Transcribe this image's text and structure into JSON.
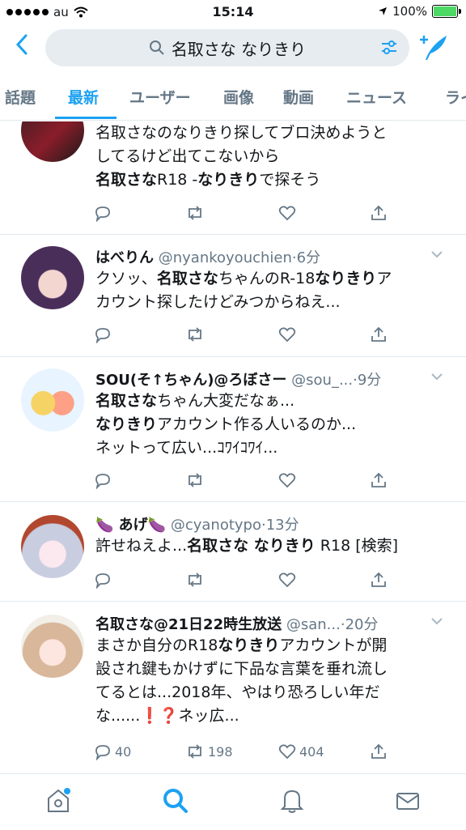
{
  "status_bar": {
    "carrier": "au",
    "time": "15:14",
    "battery": "100%",
    "battery_level": 1.0
  },
  "search": {
    "query": "名取さな なりきり"
  },
  "tabs": [
    "話題",
    "最新",
    "ユーザー",
    "画像",
    "動画",
    "ニュース",
    "ライ"
  ],
  "active_tab": "最新",
  "tweets": [
    {
      "name": "",
      "handle": "",
      "time": "",
      "body": [
        {
          "t": "名取さなのなりきり探してブロ決めようと"
        },
        {
          "br": true
        },
        {
          "t": "してるけど出てこないから"
        },
        {
          "br": true
        },
        {
          "t": "名取さな",
          "b": true
        },
        {
          "t": "R18 -"
        },
        {
          "t": "なりきり",
          "b": true
        },
        {
          "t": "で探そう"
        }
      ],
      "reply_count": "",
      "retweet_count": "",
      "like_count": ""
    },
    {
      "name": "はべりん",
      "handle": "@nyankoyouchien",
      "time": "6分",
      "body": [
        {
          "t": "クソッ、"
        },
        {
          "t": "名取さな",
          "b": true
        },
        {
          "t": "ちゃんのR-18"
        },
        {
          "t": "なりきり",
          "b": true
        },
        {
          "t": "ア"
        },
        {
          "br": true
        },
        {
          "t": "カウント探したけどみつからねえ..."
        }
      ],
      "reply_count": "",
      "retweet_count": "",
      "like_count": ""
    },
    {
      "name": "SOU(そ↑ちゃん)@ろぼさー",
      "handle": "@sou_...",
      "time": "9分",
      "body": [
        {
          "t": "名取さな",
          "b": true
        },
        {
          "t": "ちゃん大変だなぁ..."
        },
        {
          "br": true
        },
        {
          "t": "なりきり",
          "b": true
        },
        {
          "t": "アカウント作る人いるのか..."
        },
        {
          "br": true
        },
        {
          "t": "ネットって広い...ｺﾜｲｺﾜｲ..."
        }
      ],
      "reply_count": "",
      "retweet_count": "",
      "like_count": ""
    },
    {
      "name": "🍆 あげ🍆",
      "handle": "@cyanotypo",
      "time": "13分",
      "body": [
        {
          "t": "許せねえよ..."
        },
        {
          "t": "名取さな なりきり",
          "b": true
        },
        {
          "t": " R18 [検索]"
        }
      ],
      "reply_count": "",
      "retweet_count": "",
      "like_count": ""
    },
    {
      "name": "名取さな@21日22時生放送",
      "handle": "@san...",
      "time": "20分",
      "body": [
        {
          "t": "まさか自分のR18"
        },
        {
          "t": "なりきり",
          "b": true
        },
        {
          "t": "アカウントが開"
        },
        {
          "br": true
        },
        {
          "t": "設され鍵もかけずに下品な言葉を垂れ流し"
        },
        {
          "br": true
        },
        {
          "t": "てるとは...2018年、やはり恐ろしい年だ"
        },
        {
          "br": true
        },
        {
          "t": "な......❗❓ネッ広..."
        }
      ],
      "reply_count": "40",
      "retweet_count": "198",
      "like_count": "404"
    }
  ],
  "colors": {
    "accent": "#1da1f2",
    "text": "#14171a",
    "muted": "#657786",
    "divider": "#e1e8ed",
    "search_bg": "#e6ecf0",
    "battery": "#4cd964",
    "notification_dot": "#1da1f2"
  },
  "icons": {
    "back": "chevron-left-icon",
    "search": "search-icon",
    "filter": "sliders-icon",
    "compose": "compose-plus-feather-icon",
    "reply": "reply-icon",
    "retweet": "retweet-icon",
    "like": "heart-icon",
    "share": "share-icon",
    "menu": "chevron-down-icon",
    "nav": [
      "home-icon",
      "search-icon",
      "bell-icon",
      "mail-icon"
    ]
  }
}
